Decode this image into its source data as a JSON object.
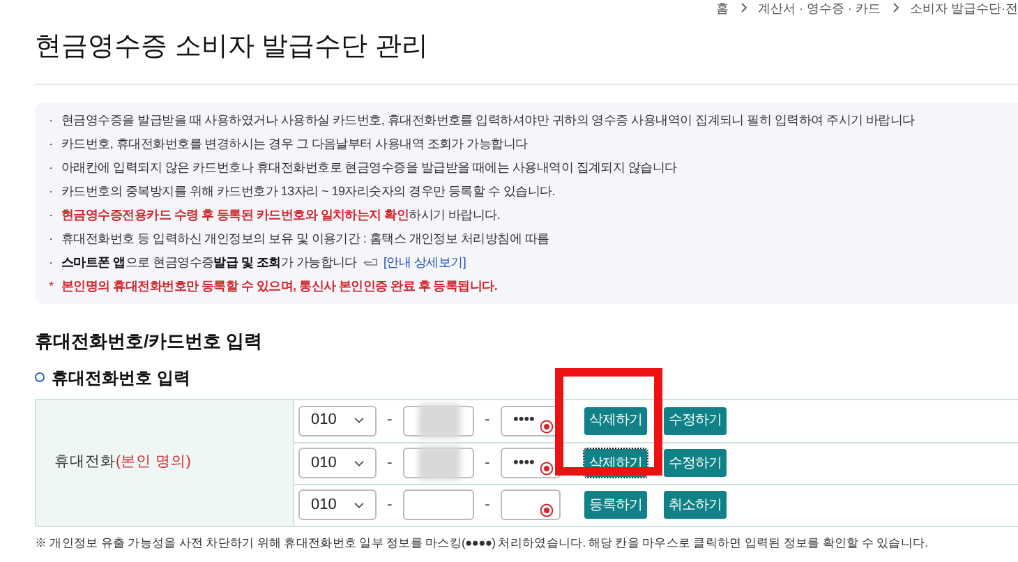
{
  "breadcrumb": [
    "홈",
    "계산서 · 영수증 · 카드",
    "소비자 발급수단·전"
  ],
  "title": "현금영수증 소비자 발급수단 관리",
  "notices": [
    {
      "bullet": "·",
      "segments": [
        {
          "kind": "plain",
          "text": "현금영수증을 발급받을 때 사용하였거나 사용하실 카드번호, 휴대전화번호를 입력하셔야만 귀하의 영수증 사용내역이 집계되니 필히 입력하여 주시기 바랍니다"
        }
      ]
    },
    {
      "bullet": "·",
      "segments": [
        {
          "kind": "plain",
          "text": "카드번호, 휴대전화번호를 변경하시는 경우 그 다음날부터 사용내역 조회가 가능합니다"
        }
      ]
    },
    {
      "bullet": "·",
      "segments": [
        {
          "kind": "plain",
          "text": "아래칸에 입력되지 않은 카드번호나 휴대전화번호로 현금영수증을 발급받을 때에는 사용내역이 집계되지 않습니다"
        }
      ]
    },
    {
      "bullet": "·",
      "segments": [
        {
          "kind": "plain",
          "text": "카드번호의 중복방지를 위해 카드번호가 13자리 ~ 19자리숫자의 경우만 등록할 수 있습니다."
        }
      ]
    },
    {
      "bullet": "·",
      "segments": [
        {
          "kind": "red",
          "text": "현금영수증전용카드 수령 후 등록된 카드번호와 일치하는지 확인"
        },
        {
          "kind": "plain",
          "text": "하시기 바랍니다."
        }
      ]
    },
    {
      "bullet": "·",
      "segments": [
        {
          "kind": "plain",
          "text": "휴대전화번호 등 입력하신 개인정보의 보유 및 이용기간 : 홈택스 개인정보 처리방침에 따름"
        }
      ]
    },
    {
      "bullet": "·",
      "segments": [
        {
          "kind": "bold",
          "text": "스마트폰 앱"
        },
        {
          "kind": "plain",
          "text": "으로 현금영수증 "
        },
        {
          "kind": "bold",
          "text": "발급 및 조회"
        },
        {
          "kind": "plain",
          "text": "가 가능합니다"
        }
      ],
      "link": "[안내 상세보기]"
    },
    {
      "bullet": "*",
      "segments": [
        {
          "kind": "red",
          "text": "본인명의 휴대전화번호만 등록할 수 있으며, 통신사 본인인증 완료 후 등록됩니다."
        }
      ]
    }
  ],
  "section_title": "휴대전화번호/카드번호 입력",
  "subsection_title": "휴대전화번호 입력",
  "phone_table": {
    "label": "휴대전화",
    "label_note": "(본인 명의)",
    "rows": [
      {
        "prefix": "010",
        "middle_blurred": true,
        "last": "••••",
        "buttons": [
          {
            "label": "삭제하기",
            "focused": false
          },
          {
            "label": "수정하기",
            "focused": false
          }
        ]
      },
      {
        "prefix": "010",
        "middle_blurred": true,
        "last": "••••",
        "buttons": [
          {
            "label": "삭제하기",
            "focused": true
          },
          {
            "label": "수정하기",
            "focused": false
          }
        ]
      },
      {
        "prefix": "010",
        "middle_blurred": false,
        "buttons": [
          {
            "label": "등록하기",
            "focused": false
          },
          {
            "label": "취소하기",
            "focused": false
          }
        ]
      }
    ]
  },
  "separator": "-",
  "footnote": "※ 개인정보 유출 가능성을 사전 차단하기 위해 휴대전화번호 일부 정보를 마스킹(●●●●) 처리하였습니다. 해당 칸을 마우스로 클릭하면 입력된 정보를 확인할 수 있습니다."
}
